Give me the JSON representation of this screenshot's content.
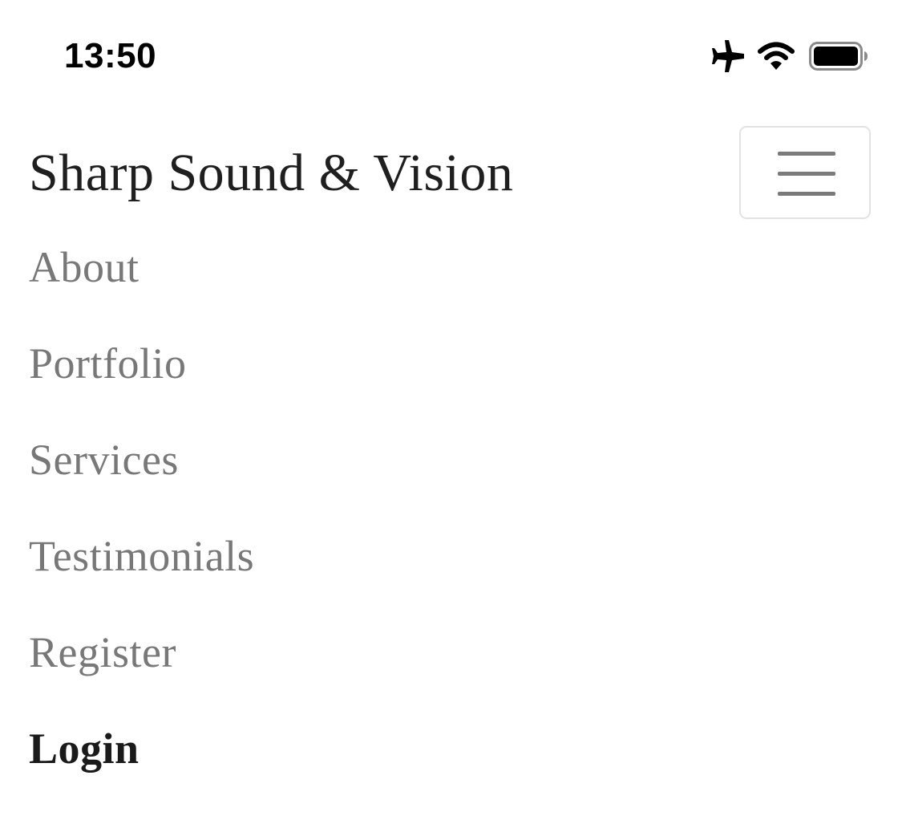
{
  "status_bar": {
    "time": "13:50",
    "icons": [
      "airplane-icon",
      "wifi-icon",
      "battery-icon"
    ]
  },
  "navbar": {
    "brand": "Sharp Sound & Vision",
    "toggler_icon": "hamburger-menu-icon",
    "links": [
      {
        "label": "About",
        "active": false
      },
      {
        "label": "Portfolio",
        "active": false
      },
      {
        "label": "Services",
        "active": false
      },
      {
        "label": "Testimonials",
        "active": false
      },
      {
        "label": "Register",
        "active": false
      },
      {
        "label": "Login",
        "active": true
      }
    ]
  },
  "colors": {
    "brand_text": "#1f1f1f",
    "link_inactive": "#787878",
    "link_active": "#1a1a1a",
    "toggler_border": "#e2e2e2",
    "toggler_bars": "#7a7a7a"
  }
}
